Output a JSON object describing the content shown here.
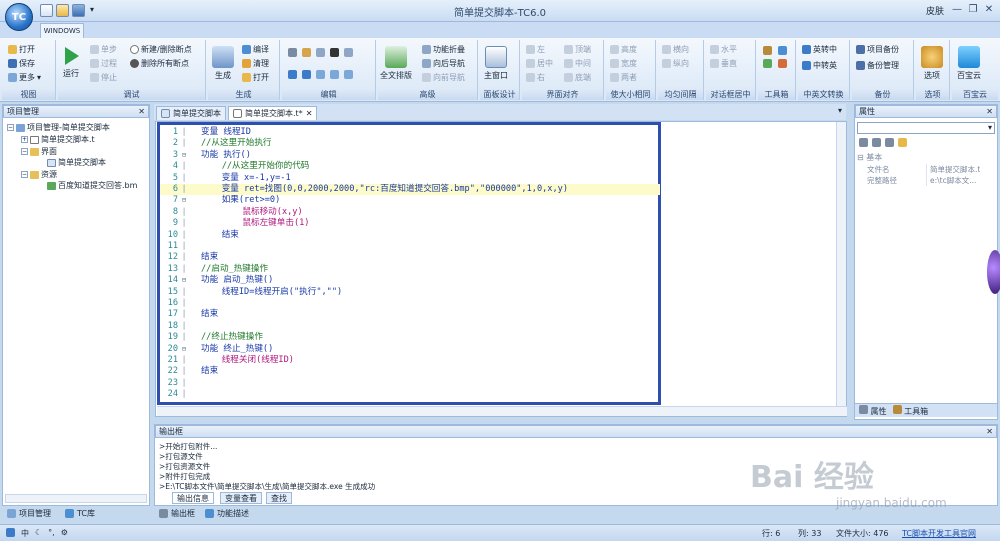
{
  "titlebar": {
    "title": "简单提交脚本-TC6.0",
    "skin": "皮肤"
  },
  "ribbon_tab": "WINDOWS",
  "ribbon": {
    "view": {
      "label": "视图",
      "items": [
        "打开",
        "保存",
        "更多"
      ]
    },
    "debug": {
      "label": "调试",
      "run": "运行",
      "items": [
        "单步",
        "过程",
        "停止",
        "新建/删除断点",
        "删除所有断点"
      ]
    },
    "build": {
      "label": "生成",
      "build": "生成",
      "items": [
        "编译",
        "清理",
        "打开"
      ]
    },
    "edit": {
      "label": "编辑"
    },
    "advanced": {
      "label": "高级",
      "full": "全文排版",
      "items": [
        "功能折叠",
        "向后导航",
        "向前导航"
      ]
    },
    "panel": {
      "label": "面板设计",
      "main": "主窗口"
    },
    "align": {
      "label": "界面对齐",
      "items": [
        "左",
        "顶端",
        "居中",
        "中间",
        "右",
        "底端"
      ]
    },
    "size": {
      "label": "使大小相同",
      "items": [
        "高度",
        "宽度",
        "两者"
      ]
    },
    "spacing": {
      "label": "均匀间隔",
      "items": [
        "横向",
        "纵向"
      ]
    },
    "center": {
      "label": "对话框居中",
      "items": [
        "水平",
        "垂直"
      ]
    },
    "toolbox": {
      "label": "工具箱"
    },
    "convert": {
      "label": "中英文转换",
      "items": [
        "英转中",
        "中转英"
      ]
    },
    "backup": {
      "label": "备份",
      "items": [
        "项目备份",
        "备份管理"
      ]
    },
    "options": {
      "label": "选项",
      "item": "选项"
    },
    "treasure": {
      "label": "百宝云",
      "item": "百宝云"
    }
  },
  "project": {
    "header": "项目管理",
    "tree": [
      {
        "label": "项目管理-简单提交脚本"
      },
      {
        "label": "简单提交脚本.t"
      },
      {
        "label": "界面"
      },
      {
        "label": "简单提交脚本"
      },
      {
        "label": "资源"
      },
      {
        "label": "百度知道提交回答.bm"
      }
    ],
    "bottom_tabs": [
      "项目管理",
      "TC库"
    ]
  },
  "editor": {
    "tabs": [
      "简单提交脚本",
      "简单提交脚本.t*"
    ],
    "lines": [
      {
        "n": "1",
        "t": "变量 线程ID"
      },
      {
        "n": "2",
        "t": "//从这里开始执行"
      },
      {
        "n": "3",
        "t": "功能 执行()"
      },
      {
        "n": "4",
        "t": "    //从这里开始你的代码"
      },
      {
        "n": "5",
        "t": "    变量 x=-1,y=-1"
      },
      {
        "n": "6",
        "t": "    变量 ret=找图(0,0,2000,2000,\"rc:百度知道提交回答.bmp\",\"000000\",1,0,x,y)"
      },
      {
        "n": "7",
        "t": "    如果(ret>=0)"
      },
      {
        "n": "8",
        "t": "        鼠标移动(x,y)"
      },
      {
        "n": "9",
        "t": "        鼠标左键单击(1)"
      },
      {
        "n": "10",
        "t": "    结束"
      },
      {
        "n": "11",
        "t": ""
      },
      {
        "n": "12",
        "t": "结束"
      },
      {
        "n": "13",
        "t": "//启动_热键操作"
      },
      {
        "n": "14",
        "t": "功能 启动_热键()"
      },
      {
        "n": "15",
        "t": "    线程ID=线程开启(\"执行\",\"\")"
      },
      {
        "n": "16",
        "t": ""
      },
      {
        "n": "17",
        "t": "结束"
      },
      {
        "n": "18",
        "t": ""
      },
      {
        "n": "19",
        "t": "//终止热键操作"
      },
      {
        "n": "20",
        "t": "功能 终止_热键()"
      },
      {
        "n": "21",
        "t": "    线程关闭(线程ID)"
      },
      {
        "n": "22",
        "t": "结束"
      },
      {
        "n": "23",
        "t": ""
      },
      {
        "n": "24",
        "t": ""
      }
    ]
  },
  "properties": {
    "header": "属性",
    "category": "基本",
    "rows": [
      {
        "k": "文件名",
        "v": "简单提交脚本.t"
      },
      {
        "k": "完整路径",
        "v": "e:\\tc脚本文..."
      }
    ],
    "tabs": [
      "属性",
      "工具箱"
    ]
  },
  "output": {
    "header": "输出框",
    "lines": [
      ">开始打包附件...",
      ">打包源文件",
      ">打包资源文件",
      ">附件打包完成",
      ">E:\\TC脚本文件\\简单提交脚本\\生成\\简单提交脚本.exe 生成成功"
    ],
    "tabs": [
      "输出信息",
      "变量查看",
      "查找"
    ],
    "bottom_tabs": [
      "输出框",
      "功能描述"
    ]
  },
  "status": {
    "line": "行: 6",
    "col": "列: 33",
    "size": "文件大小: 476",
    "link": "TC脚本开发工具官网"
  },
  "watermark": {
    "brand": "Bai 经验",
    "url": "jingyan.baidu.com"
  },
  "colors": {
    "box": "#2f4fb0",
    "keyword": "#1a3aa8",
    "comment": "#1f7a2a",
    "function": "#b0177e",
    "highlight": "#fdfbc9"
  }
}
